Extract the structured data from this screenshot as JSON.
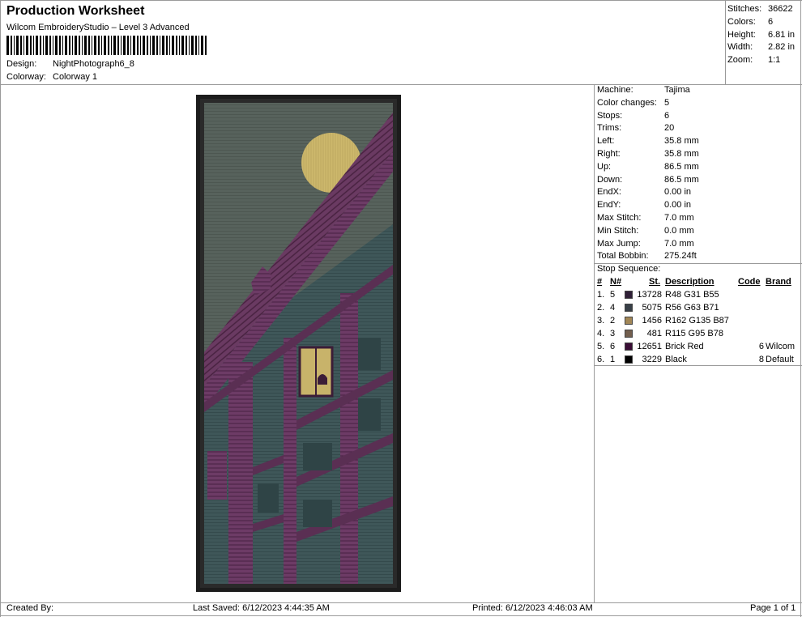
{
  "header": {
    "title": "Production Worksheet",
    "subtitle": "Wilcom EmbroideryStudio – Level 3 Advanced",
    "design_label": "Design:",
    "design_value": "NightPhotograph6_8",
    "colorway_label": "Colorway:",
    "colorway_value": "Colorway 1"
  },
  "summary": [
    {
      "label": "Stitches:",
      "value": "36622"
    },
    {
      "label": "Colors:",
      "value": "6"
    },
    {
      "label": "Height:",
      "value": "6.81 in"
    },
    {
      "label": "Width:",
      "value": "2.82 in"
    },
    {
      "label": "Zoom:",
      "value": "1:1"
    }
  ],
  "machine_info": [
    {
      "label": "Machine:",
      "value": "Tajima"
    },
    {
      "label": "Color changes:",
      "value": "5"
    },
    {
      "label": "Stops:",
      "value": "6"
    },
    {
      "label": "Trims:",
      "value": "20"
    },
    {
      "label": "Left:",
      "value": "35.8 mm"
    },
    {
      "label": "Right:",
      "value": "35.8 mm"
    },
    {
      "label": "Up:",
      "value": "86.5 mm"
    },
    {
      "label": "Down:",
      "value": "86.5 mm"
    },
    {
      "label": "EndX:",
      "value": "0.00 in"
    },
    {
      "label": "EndY:",
      "value": "0.00 in"
    },
    {
      "label": "Max Stitch:",
      "value": "7.0 mm"
    },
    {
      "label": "Min Stitch:",
      "value": "0.0 mm"
    },
    {
      "label": "Max Jump:",
      "value": "7.0 mm"
    },
    {
      "label": "Total Bobbin:",
      "value": "275.24ft"
    }
  ],
  "stop_sequence": {
    "title": "Stop Sequence:",
    "headers": {
      "num": "#",
      "n": "N#",
      "st": "St.",
      "description": "Description",
      "code": "Code",
      "brand": "Brand"
    },
    "rows": [
      {
        "num": "1.",
        "n": "5",
        "color": "#301F37",
        "st": "13728",
        "description": "R48 G31 B55",
        "code": "",
        "brand": ""
      },
      {
        "num": "2.",
        "n": "4",
        "color": "#383F47",
        "st": "5075",
        "description": "R56 G63 B71",
        "code": "",
        "brand": ""
      },
      {
        "num": "3.",
        "n": "2",
        "color": "#A28757",
        "st": "1456",
        "description": "R162 G135 B87",
        "code": "",
        "brand": ""
      },
      {
        "num": "4.",
        "n": "3",
        "color": "#735F4E",
        "st": "481",
        "description": "R115 G95 B78",
        "code": "",
        "brand": ""
      },
      {
        "num": "5.",
        "n": "6",
        "color": "#3A0D36",
        "st": "12651",
        "description": "Brick Red",
        "code": "6",
        "brand": "Wilcom"
      },
      {
        "num": "6.",
        "n": "1",
        "color": "#000000",
        "st": "3229",
        "description": "Black",
        "code": "8",
        "brand": "Default"
      }
    ]
  },
  "footer": {
    "created_by": "Created By:",
    "last_saved": "Last Saved: 6/12/2023 4:44:35 AM",
    "printed": "Printed: 6/12/2023 4:46:03 AM",
    "page": "Page 1 of 1"
  },
  "colors": {
    "sky": "#55605a",
    "moon": "#c9b46a",
    "building_teal": "#3d5558",
    "building_purple": "#6a3a62",
    "border": "#1a1a1a"
  }
}
